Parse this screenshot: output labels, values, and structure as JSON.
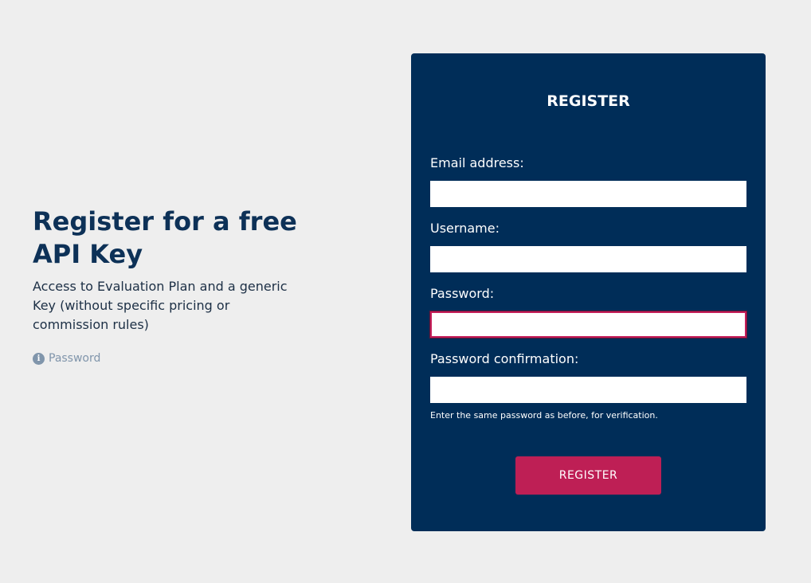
{
  "intro": {
    "heading": "Register for a free API Key",
    "description": "Access to Evaluation Plan and a generic Key (without specific pricing or commission rules)",
    "info_icon": "info-circle-icon",
    "info_link_label": "Password"
  },
  "form": {
    "title": "REGISTER",
    "fields": [
      {
        "label": "Email address:",
        "value": "",
        "placeholder": ""
      },
      {
        "label": "Username:",
        "value": "",
        "placeholder": ""
      },
      {
        "label": "Password:",
        "value": "",
        "placeholder": ""
      },
      {
        "label": "Password confirmation:",
        "value": "",
        "placeholder": ""
      }
    ],
    "help_text": "Enter the same password as before, for verification.",
    "submit_label": "REGISTER"
  },
  "colors": {
    "page_background": "#eeeeee",
    "panel_background": "#002d58",
    "heading_text": "#0d3157",
    "accent_button": "#be1f55",
    "focus_border": "#c41e5a",
    "info_gray": "#8095ab"
  }
}
